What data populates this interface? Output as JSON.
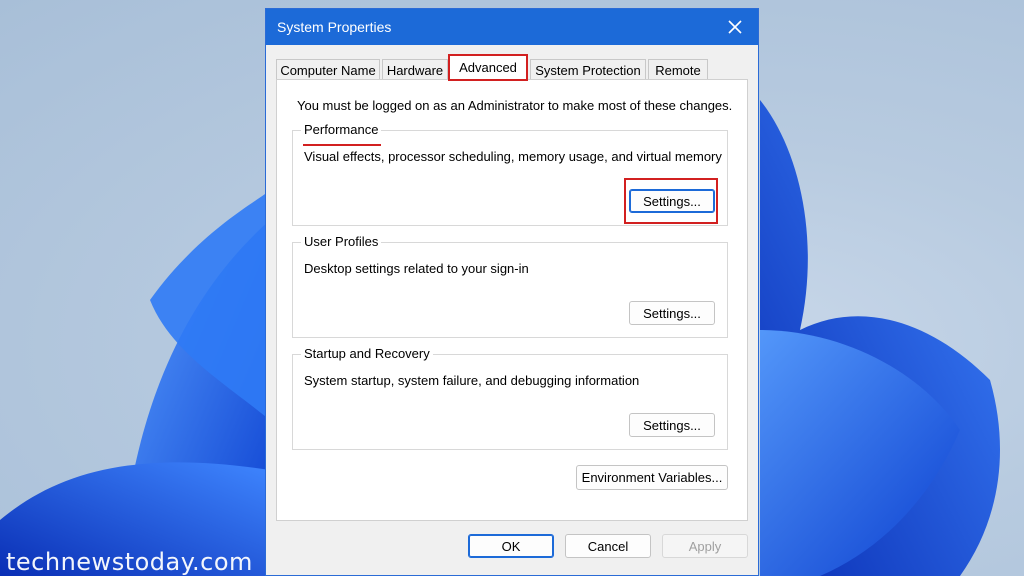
{
  "window": {
    "title": "System Properties"
  },
  "tabs": [
    {
      "label": "Computer Name"
    },
    {
      "label": "Hardware"
    },
    {
      "label": "Advanced"
    },
    {
      "label": "System Protection"
    },
    {
      "label": "Remote"
    }
  ],
  "active_tab": "Advanced",
  "notice": "You must be logged on as an Administrator to make most of these changes.",
  "groups": {
    "performance": {
      "title": "Performance",
      "description": "Visual effects, processor scheduling, memory usage, and virtual memory",
      "button": "Settings..."
    },
    "user_profiles": {
      "title": "User Profiles",
      "description": "Desktop settings related to your sign-in",
      "button": "Settings..."
    },
    "startup_recovery": {
      "title": "Startup and Recovery",
      "description": "System startup, system failure, and debugging information",
      "button": "Settings..."
    }
  },
  "env_button": "Environment Variables...",
  "footer": {
    "ok": "OK",
    "cancel": "Cancel",
    "apply": "Apply"
  },
  "watermark": "technewstoday.com",
  "colors": {
    "titlebar": "#1c6ad8",
    "highlight": "#d22020"
  },
  "icons": {
    "close": "close-icon"
  }
}
